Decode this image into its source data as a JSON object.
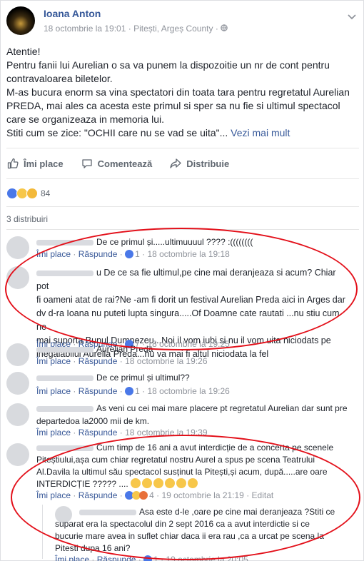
{
  "post": {
    "author": "Ioana Anton",
    "date": "18 octombrie la 19:01",
    "location": "Pitești, Argeș County",
    "privacy_icon": "globe-icon",
    "lines": [
      "Atentie!",
      "Pentru fanii lui Aurelian o sa va punem la dispozoitie un nr de cont pentru",
      "contravaloarea biletelor.",
      "M-as bucura enorm sa vina spectatori din toata tara pentru regretatul Aurelian",
      "PREDA, mai ales ca acesta este primul si sper sa nu fie si ultimul spectacol",
      "care se organizeaza in memoria lui.",
      "Stiti cum se zice: \"OCHII care nu se vad se uita\"..."
    ],
    "see_more": "Vezi mai mult"
  },
  "actions": {
    "like": "Îmi place",
    "comment": "Comentează",
    "share": "Distribuie"
  },
  "reactions": {
    "count": "84"
  },
  "shares": {
    "label": "3 distribuiri"
  },
  "comments": [
    {
      "text": "De ce primul și.....ultimuuuul ???? :((((((((",
      "like": "Îmi place",
      "reply": "Răspunde",
      "likes": "1",
      "date": "18 octombrie la 19:18"
    },
    {
      "lines": [
        "u De ce sa fie ultimul,pe cine mai deranjeaza si acum? Chiar pot",
        "fi oameni atat de rai?Ne -am fi dorit un festival Aurelian Preda aici in Arges dar",
        "dv d-ra Ioana nu puteti lupta singura.....Of Doamne cate rautati ...nu stiu cum ne",
        "mai suporta Bunul Dumnezeu...Noi il vom iubi si nu il vom uita niciodats pe",
        "inegalabilul Aurelia Preda...nu va mai fi altul niciodata la fel"
      ],
      "like": "Îmi place",
      "reply": "Răspunde",
      "likes": "7",
      "date": "18 octombrie la 19:25"
    },
    {
      "text": "Aurelian Preda",
      "like": "Îmi place",
      "reply": "Răspunde",
      "date": "18 octombrie la 19:26"
    },
    {
      "text": "De ce primul și ultimul??",
      "like": "Îmi place",
      "reply": "Răspunde",
      "likes": "1",
      "date": "18 octombrie la 19:26"
    },
    {
      "lines": [
        "As veni cu cei mai mare placere pt regretatul Aurelian dar sunt pre",
        "departedoa la2000 mii de km."
      ],
      "like": "Îmi place",
      "reply": "Răspunde",
      "date": "18 octombrie la 19:39"
    },
    {
      "lines": [
        "Cum timp de 16 ani a avut interdicție de a concerta pe scenele",
        "Piteștiului,așa cum chiar regretatul nostru Aurel a spus pe scena Teatrului",
        "Al.Davila la ultimul său spectacol susținut la Pitești,și acum, după.....are oare",
        "INTERDICȚIE ????? ...."
      ],
      "like": "Îmi place",
      "reply": "Răspunde",
      "likes": "4",
      "date": "19 octombrie la 21:19",
      "edited": "Editat"
    },
    {
      "lines": [
        "Asa este d-le ,oare pe cine mai deranjeaza ?Stiti ce",
        "suparat era la spectacolul din 2 sept 2016 ca a avut interdictie si ce",
        "bucurie mare avea in suflet chiar daca ii era rau ,ca a urcat pe scena la",
        "Pitesti dupa 16 ani?"
      ],
      "like": "Îmi place",
      "reply": "Răspunde",
      "likes": "1",
      "date": "19 octombrie la 20:05"
    }
  ],
  "colors": {
    "link": "#365899",
    "annotation": "#e3101a",
    "meta": "#90949c"
  }
}
